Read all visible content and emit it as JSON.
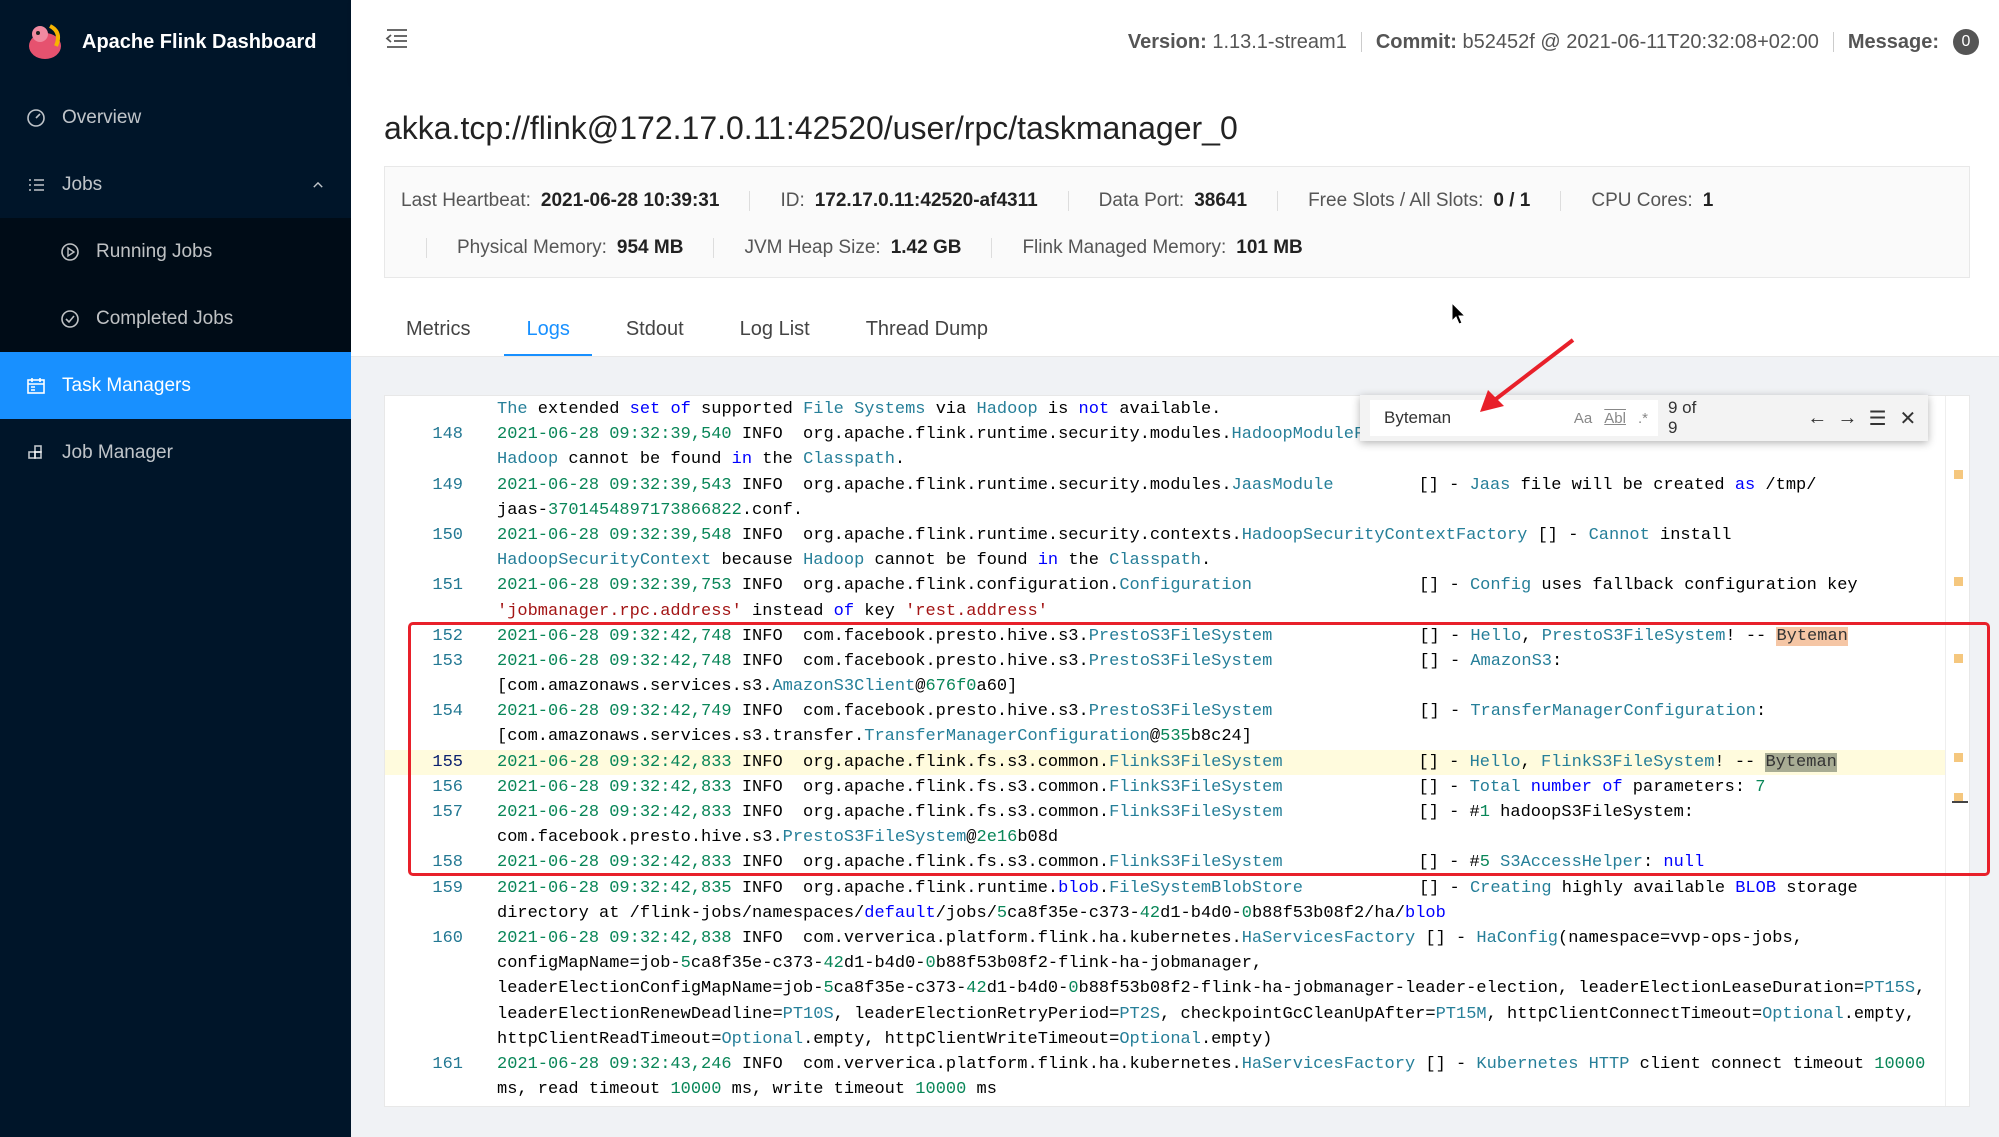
{
  "app": {
    "title": "Apache Flink Dashboard"
  },
  "sidebar": {
    "items": [
      {
        "label": "Overview",
        "icon": "dashboard-icon"
      },
      {
        "label": "Jobs",
        "icon": "list-icon"
      },
      {
        "label": "Running Jobs",
        "icon": "play-circle-icon"
      },
      {
        "label": "Completed Jobs",
        "icon": "check-circle-icon"
      },
      {
        "label": "Task Managers",
        "icon": "schedule-icon"
      },
      {
        "label": "Job Manager",
        "icon": "build-icon"
      }
    ]
  },
  "header": {
    "version_label": "Version:",
    "version": "1.13.1-stream1",
    "commit_label": "Commit:",
    "commit": "b52452f @ 2021-06-11T20:32:08+02:00",
    "message_label": "Message:",
    "message_count": "0"
  },
  "page": {
    "title": "akka.tcp://flink@172.17.0.11:42520/user/rpc/taskmanager_0"
  },
  "info": {
    "row1": [
      {
        "label": "Last Heartbeat:",
        "value": "2021-06-28 10:39:31"
      },
      {
        "label": "ID:",
        "value": "172.17.0.11:42520-af4311"
      },
      {
        "label": "Data Port:",
        "value": "38641"
      },
      {
        "label": "Free Slots / All Slots:",
        "value": "0 / 1"
      },
      {
        "label": "CPU Cores:",
        "value": "1"
      }
    ],
    "row2": [
      {
        "label": "Physical Memory:",
        "value": "954 MB"
      },
      {
        "label": "JVM Heap Size:",
        "value": "1.42 GB"
      },
      {
        "label": "Flink Managed Memory:",
        "value": "101 MB"
      }
    ]
  },
  "tabs": [
    "Metrics",
    "Logs",
    "Stdout",
    "Log List",
    "Thread Dump"
  ],
  "active_tab": "Logs",
  "find": {
    "query": "Byteman",
    "case_label": "Aa",
    "word_label": "Abl",
    "regex_label": ".*",
    "count": "9 of 9"
  },
  "log": [
    {
      "num": "",
      "rows": [
        [
          [
            "c",
            "The"
          ],
          [
            "p",
            " extended "
          ],
          [
            "k",
            "set"
          ],
          [
            "p",
            " "
          ],
          [
            "k",
            "of"
          ],
          [
            "p",
            " supported "
          ],
          [
            "c",
            "File Systems"
          ],
          [
            "p",
            " via "
          ],
          [
            "c",
            "Hadoop"
          ],
          [
            "p",
            " is "
          ],
          [
            "k",
            "not"
          ],
          [
            "p",
            " available."
          ]
        ]
      ]
    },
    {
      "num": "148",
      "rows": [
        [
          [
            "g",
            "2021-06-28 09:32:39,540"
          ],
          [
            "p",
            " INFO  org.apache.flink.runtime.security.modules."
          ],
          [
            "c",
            "HadoopModuleF"
          ]
        ],
        [
          [
            "c",
            "Hadoop"
          ],
          [
            "p",
            " cannot be found "
          ],
          [
            "k",
            "in"
          ],
          [
            "p",
            " the "
          ],
          [
            "c",
            "Classpath"
          ],
          [
            "p",
            "."
          ]
        ]
      ]
    },
    {
      "num": "149",
      "rows": [
        [
          [
            "g",
            "2021-06-28 09:32:39,543"
          ],
          [
            "p",
            " INFO  org.apache.flink.runtime.security.modules."
          ],
          [
            "c",
            "JaasModule"
          ],
          [
            "|"
          ],
          [
            "p",
            "[] - "
          ],
          [
            "c",
            "Jaas"
          ],
          [
            "p",
            " file will be created "
          ],
          [
            "k",
            "as"
          ],
          [
            "p",
            " /tmp/"
          ]
        ],
        [
          [
            "p",
            "jaas-"
          ],
          [
            "g",
            "3701454897173866822"
          ],
          [
            "p",
            ".conf."
          ]
        ]
      ]
    },
    {
      "num": "150",
      "rows": [
        [
          [
            "g",
            "2021-06-28 09:32:39,548"
          ],
          [
            "p",
            " INFO  org.apache.flink.runtime.security.contexts."
          ],
          [
            "c",
            "HadoopSecurityContextFactory"
          ],
          [
            "p",
            " [] - "
          ],
          [
            "c",
            "Cannot"
          ],
          [
            "p",
            " install"
          ]
        ],
        [
          [
            "c",
            "HadoopSecurityContext"
          ],
          [
            "p",
            " because "
          ],
          [
            "c",
            "Hadoop"
          ],
          [
            "p",
            " cannot be found "
          ],
          [
            "k",
            "in"
          ],
          [
            "p",
            " the "
          ],
          [
            "c",
            "Classpath"
          ],
          [
            "p",
            "."
          ]
        ]
      ]
    },
    {
      "num": "151",
      "rows": [
        [
          [
            "g",
            "2021-06-28 09:32:39,753"
          ],
          [
            "p",
            " INFO  org.apache.flink.configuration."
          ],
          [
            "c",
            "Configuration"
          ],
          [
            "|"
          ],
          [
            "p",
            "[] - "
          ],
          [
            "c",
            "Config"
          ],
          [
            "p",
            " uses fallback configuration key"
          ]
        ],
        [
          [
            "s",
            "'jobmanager.rpc.address'"
          ],
          [
            "p",
            " instead "
          ],
          [
            "k",
            "of"
          ],
          [
            "p",
            " key "
          ],
          [
            "s",
            "'rest.address'"
          ]
        ]
      ]
    },
    {
      "num": "152",
      "rows": [
        [
          [
            "g",
            "2021-06-28 09:32:42,748"
          ],
          [
            "p",
            " INFO  com.facebook.presto.hive.s3."
          ],
          [
            "c",
            "PrestoS3FileSystem"
          ],
          [
            "|"
          ],
          [
            "p",
            "[] - "
          ],
          [
            "c",
            "Hello"
          ],
          [
            "p",
            ", "
          ],
          [
            "c",
            "PrestoS3FileSystem"
          ],
          [
            "p",
            "! -- "
          ],
          [
            "m",
            "Byteman"
          ]
        ]
      ]
    },
    {
      "num": "153",
      "rows": [
        [
          [
            "g",
            "2021-06-28 09:32:42,748"
          ],
          [
            "p",
            " INFO  com.facebook.presto.hive.s3."
          ],
          [
            "c",
            "PrestoS3FileSystem"
          ],
          [
            "|"
          ],
          [
            "p",
            "[] - "
          ],
          [
            "c",
            "AmazonS3"
          ],
          [
            "p",
            ":"
          ]
        ],
        [
          [
            "p",
            "[com.amazonaws.services.s3."
          ],
          [
            "c",
            "AmazonS3Client"
          ],
          [
            "p",
            "@"
          ],
          [
            "g",
            "676f0"
          ],
          [
            "p",
            "a60]"
          ]
        ]
      ]
    },
    {
      "num": "154",
      "rows": [
        [
          [
            "g",
            "2021-06-28 09:32:42,749"
          ],
          [
            "p",
            " INFO  com.facebook.presto.hive.s3."
          ],
          [
            "c",
            "PrestoS3FileSystem"
          ],
          [
            "|"
          ],
          [
            "p",
            "[] - "
          ],
          [
            "c",
            "TransferManagerConfiguration"
          ],
          [
            "p",
            ":"
          ]
        ],
        [
          [
            "p",
            "[com.amazonaws.services.s3.transfer."
          ],
          [
            "c",
            "TransferManagerConfiguration"
          ],
          [
            "p",
            "@"
          ],
          [
            "g",
            "535"
          ],
          [
            "p",
            "b8c24]"
          ]
        ]
      ]
    },
    {
      "num": "155",
      "current": true,
      "rows": [
        [
          [
            "g",
            "2021-06-28 09:32:42,833"
          ],
          [
            "p",
            " INFO  org.apache.flink.fs.s3.common."
          ],
          [
            "c",
            "FlinkS3FileSystem"
          ],
          [
            "|"
          ],
          [
            "p",
            "[] - "
          ],
          [
            "c",
            "Hello"
          ],
          [
            "p",
            ", "
          ],
          [
            "c",
            "FlinkS3FileSystem"
          ],
          [
            "p",
            "! -- "
          ],
          [
            "mc",
            "Byteman"
          ]
        ]
      ]
    },
    {
      "num": "156",
      "rows": [
        [
          [
            "g",
            "2021-06-28 09:32:42,833"
          ],
          [
            "p",
            " INFO  org.apache.flink.fs.s3.common."
          ],
          [
            "c",
            "FlinkS3FileSystem"
          ],
          [
            "|"
          ],
          [
            "p",
            "[] - "
          ],
          [
            "c",
            "Total"
          ],
          [
            "p",
            " "
          ],
          [
            "k",
            "number"
          ],
          [
            "p",
            " "
          ],
          [
            "k",
            "of"
          ],
          [
            "p",
            " parameters: "
          ],
          [
            "g",
            "7"
          ]
        ]
      ]
    },
    {
      "num": "157",
      "rows": [
        [
          [
            "g",
            "2021-06-28 09:32:42,833"
          ],
          [
            "p",
            " INFO  org.apache.flink.fs.s3.common."
          ],
          [
            "c",
            "FlinkS3FileSystem"
          ],
          [
            "|"
          ],
          [
            "p",
            "[] - #"
          ],
          [
            "g",
            "1"
          ],
          [
            "p",
            " hadoopS3FileSystem:"
          ]
        ],
        [
          [
            "p",
            "com.facebook.presto.hive.s3."
          ],
          [
            "c",
            "PrestoS3FileSystem"
          ],
          [
            "p",
            "@"
          ],
          [
            "g",
            "2e16"
          ],
          [
            "p",
            "b08d"
          ]
        ]
      ]
    },
    {
      "num": "158",
      "rows": [
        [
          [
            "g",
            "2021-06-28 09:32:42,833"
          ],
          [
            "p",
            " INFO  org.apache.flink.fs.s3.common."
          ],
          [
            "c",
            "FlinkS3FileSystem"
          ],
          [
            "|"
          ],
          [
            "p",
            "[] - #"
          ],
          [
            "g",
            "5"
          ],
          [
            "p",
            " "
          ],
          [
            "c",
            "S3AccessHelper"
          ],
          [
            "p",
            ": "
          ],
          [
            "k",
            "null"
          ]
        ]
      ]
    },
    {
      "num": "159",
      "rows": [
        [
          [
            "g",
            "2021-06-28 09:32:42,835"
          ],
          [
            "p",
            " INFO  org.apache.flink.runtime."
          ],
          [
            "k",
            "blob"
          ],
          [
            "p",
            "."
          ],
          [
            "c",
            "FileSystemBlobStore"
          ],
          [
            "|"
          ],
          [
            "p",
            "[] - "
          ],
          [
            "c",
            "Creating"
          ],
          [
            "p",
            " highly available "
          ],
          [
            "k",
            "BLOB"
          ],
          [
            "p",
            " storage"
          ]
        ],
        [
          [
            "p",
            "directory at /flink-jobs/namespaces/"
          ],
          [
            "k",
            "default"
          ],
          [
            "p",
            "/jobs/"
          ],
          [
            "g",
            "5"
          ],
          [
            "p",
            "ca8f35e-c373-"
          ],
          [
            "g",
            "42"
          ],
          [
            "p",
            "d1-b4d0-"
          ],
          [
            "g",
            "0"
          ],
          [
            "p",
            "b88f53b08f2/ha/"
          ],
          [
            "k",
            "blob"
          ]
        ]
      ]
    },
    {
      "num": "160",
      "rows": [
        [
          [
            "g",
            "2021-06-28 09:32:42,838"
          ],
          [
            "p",
            " INFO  com.ververica.platform.flink.ha.kubernetes."
          ],
          [
            "c",
            "HaServicesFactory"
          ],
          [
            "p",
            " [] - "
          ],
          [
            "c",
            "HaConfig"
          ],
          [
            "p",
            "(namespace=vvp-ops-jobs,"
          ]
        ],
        [
          [
            "p",
            "configMapName=job-"
          ],
          [
            "g",
            "5"
          ],
          [
            "p",
            "ca8f35e-c373-"
          ],
          [
            "g",
            "42"
          ],
          [
            "p",
            "d1-b4d0-"
          ],
          [
            "g",
            "0"
          ],
          [
            "p",
            "b88f53b08f2-flink-ha-jobmanager,"
          ]
        ],
        [
          [
            "p",
            "leaderElectionConfigMapName=job-"
          ],
          [
            "g",
            "5"
          ],
          [
            "p",
            "ca8f35e-c373-"
          ],
          [
            "g",
            "42"
          ],
          [
            "p",
            "d1-b4d0-"
          ],
          [
            "g",
            "0"
          ],
          [
            "p",
            "b88f53b08f2-flink-ha-jobmanager-leader-election, leaderElectionLeaseDuration="
          ],
          [
            "c",
            "PT15S"
          ],
          [
            "p",
            ","
          ]
        ],
        [
          [
            "p",
            "leaderElectionRenewDeadline="
          ],
          [
            "c",
            "PT10S"
          ],
          [
            "p",
            ", leaderElectionRetryPeriod="
          ],
          [
            "c",
            "PT2S"
          ],
          [
            "p",
            ", checkpointGcCleanUpAfter="
          ],
          [
            "c",
            "PT15M"
          ],
          [
            "p",
            ", httpClientConnectTimeout="
          ],
          [
            "c",
            "Optional"
          ],
          [
            "p",
            ".empty,"
          ]
        ],
        [
          [
            "p",
            "httpClientReadTimeout="
          ],
          [
            "c",
            "Optional"
          ],
          [
            "p",
            ".empty, httpClientWriteTimeout="
          ],
          [
            "c",
            "Optional"
          ],
          [
            "p",
            ".empty)"
          ]
        ]
      ]
    },
    {
      "num": "161",
      "rows": [
        [
          [
            "g",
            "2021-06-28 09:32:43,246"
          ],
          [
            "p",
            " INFO  com.ververica.platform.flink.ha.kubernetes."
          ],
          [
            "c",
            "HaServicesFactory"
          ],
          [
            "p",
            " [] - "
          ],
          [
            "c",
            "Kubernetes HTTP"
          ],
          [
            "p",
            " client connect timeout "
          ],
          [
            "g",
            "10000"
          ]
        ],
        [
          [
            "p",
            "ms, read timeout "
          ],
          [
            "g",
            "10000"
          ],
          [
            "p",
            " ms, write timeout "
          ],
          [
            "g",
            "10000"
          ],
          [
            "p",
            " ms"
          ]
        ]
      ]
    }
  ],
  "colors": {
    "sidebar": "#001529",
    "accent": "#1890ff",
    "annotation": "#e8202a"
  }
}
